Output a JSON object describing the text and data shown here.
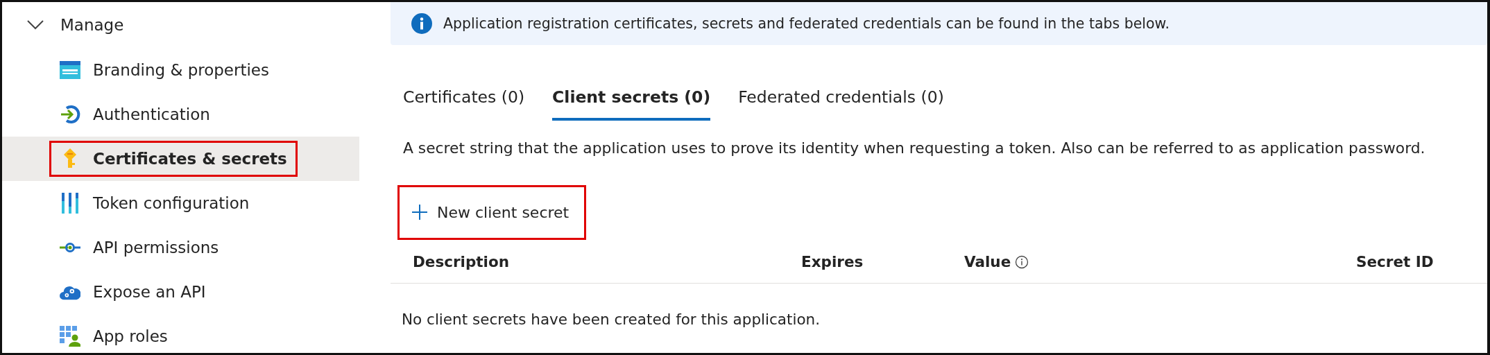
{
  "sidebar": {
    "group": {
      "label": "Manage",
      "expanded": true
    },
    "items": [
      {
        "label": "Branding & properties",
        "kind": "www",
        "selected": false,
        "callout": false
      },
      {
        "label": "Authentication",
        "kind": "auth",
        "selected": false,
        "callout": false
      },
      {
        "label": "Certificates & secrets",
        "kind": "key",
        "selected": true,
        "callout": true
      },
      {
        "label": "Token configuration",
        "kind": "token",
        "selected": false,
        "callout": false
      },
      {
        "label": "API permissions",
        "kind": "api",
        "selected": false,
        "callout": false
      },
      {
        "label": "Expose an API",
        "kind": "cloud",
        "selected": false,
        "callout": false
      },
      {
        "label": "App roles",
        "kind": "roles",
        "selected": false,
        "callout": false
      }
    ]
  },
  "info_banner": {
    "text": "Application registration certificates, secrets and federated credentials can be found in the tabs below."
  },
  "tabs": [
    {
      "label": "Certificates (0)",
      "selected": false
    },
    {
      "label": "Client secrets (0)",
      "selected": true
    },
    {
      "label": "Federated credentials (0)",
      "selected": false
    }
  ],
  "description": "A secret string that the application uses to prove its identity when requesting a token. Also can be referred to as application password.",
  "new_button": {
    "label": "New client secret",
    "callout": true
  },
  "table": {
    "columns": [
      {
        "label": "Description",
        "info": false
      },
      {
        "label": "Expires",
        "info": false
      },
      {
        "label": "Value",
        "info": true
      },
      {
        "label": "Secret ID",
        "info": false
      }
    ],
    "empty_text": "No client secrets have been created for this application."
  }
}
